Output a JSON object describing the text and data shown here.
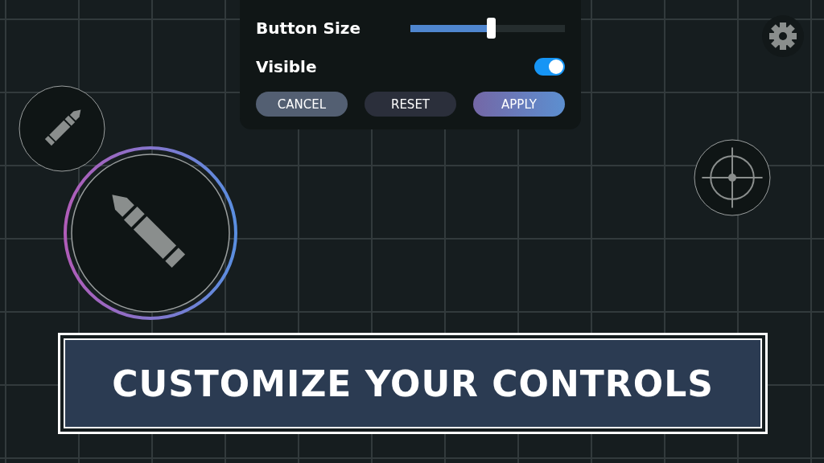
{
  "settings_panel": {
    "slider": {
      "label": "Button Size",
      "level": 0.52
    },
    "toggle": {
      "label": "Visible",
      "on": true
    },
    "buttons": [
      {
        "label": "CANCEL",
        "kind": "secondary"
      },
      {
        "label": "RESET",
        "kind": "neutral"
      },
      {
        "label": "APPLY",
        "kind": "primary"
      }
    ]
  },
  "controls": [
    {
      "kind": "fire",
      "selected": false
    },
    {
      "kind": "fire",
      "selected": true
    },
    {
      "kind": "aim",
      "selected": false
    }
  ],
  "banner": {
    "title": "CUSTOMIZE YOUR CONTROLS"
  }
}
